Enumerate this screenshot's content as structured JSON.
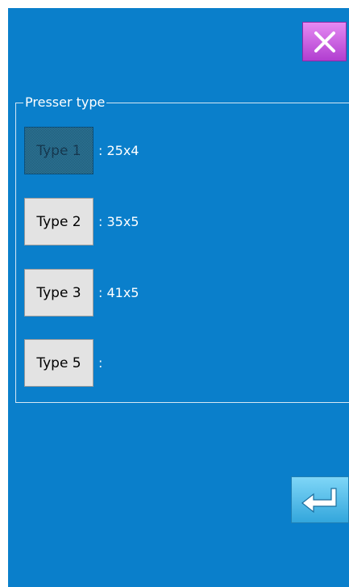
{
  "icons": {
    "close": "close-icon",
    "enter": "enter-return-icon"
  },
  "presser": {
    "title": "Presser type",
    "items": [
      {
        "label": "Type 1",
        "value": ": 25x4",
        "selected": true
      },
      {
        "label": "Type 2",
        "value": ": 35x5",
        "selected": false
      },
      {
        "label": "Type 3",
        "value": ": 41x5",
        "selected": false
      },
      {
        "label": "Type 5",
        "value": ":",
        "selected": false
      }
    ]
  },
  "colors": {
    "background": "#0a7fcb",
    "close_button": "#c052dc",
    "enter_button": "#4db8e8"
  }
}
